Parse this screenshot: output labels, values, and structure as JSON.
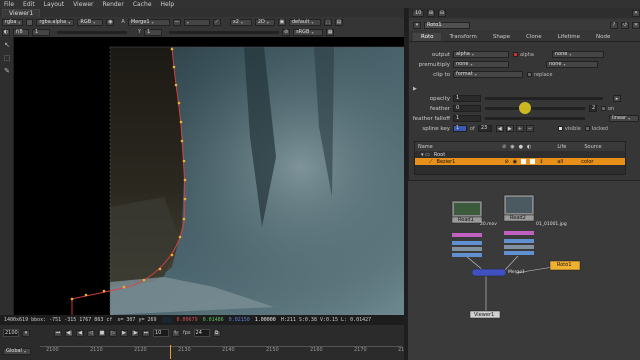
{
  "menu": [
    "File",
    "Edit",
    "Layout",
    "Viewer",
    "Render",
    "Cache",
    "Help"
  ],
  "viewer": {
    "tab": "Viewer1",
    "toolbar1": {
      "channels": "rgba",
      "layer": "rgba.alpha",
      "colorspace": "RGB",
      "input_a": "A",
      "merge": "Merge1",
      "zoom": "x2",
      "mode": "2D",
      "lut": "default"
    },
    "toolbar2": {
      "fstop": "f/8",
      "frame_val": "1",
      "y_label": "Y",
      "y_val": "1",
      "colorspace": "sRGB"
    },
    "status": {
      "info": "1400x619 bbox: -751 -315 1767 863 cf",
      "coords": "x= 307 y= 269",
      "r": "0.00679",
      "g": "0.01486",
      "b": "0.02150",
      "a": "1.00000",
      "hsvl": "H:211 S:0.38 V:0.15 L: 0.01427"
    }
  },
  "timeline": {
    "current_frame": "2100",
    "ticks": [
      "2100",
      "2110",
      "2120",
      "2130",
      "2140",
      "2150",
      "2160",
      "2170",
      "2180"
    ],
    "fps_label": "fps",
    "fps": "24",
    "step": "10",
    "range_mode": "Global"
  },
  "properties": {
    "top_count": "10",
    "node_name": "Roto1",
    "tabs": [
      "Roto",
      "Transform",
      "Shape",
      "Clone",
      "Lifetime",
      "Node"
    ],
    "output": {
      "label": "output",
      "value": "alpha",
      "check_label": "alpha",
      "extra": "none"
    },
    "premultiply": {
      "label": "premultiply",
      "value": "none",
      "extra": "none"
    },
    "clip_to": {
      "label": "clip to",
      "value": "format",
      "check_label": "replace"
    },
    "opacity": {
      "label": "opacity",
      "value": "1"
    },
    "feather": {
      "label": "feather",
      "value": "0",
      "on_label": "on",
      "num": "2"
    },
    "feather_falloff": {
      "label": "feather falloff",
      "value": "1",
      "curve": "linear"
    },
    "spline_key": {
      "label": "spline key",
      "value": "1",
      "of": "of",
      "total": "23",
      "visible": "visible",
      "locked": "locked"
    },
    "layers": {
      "headers": [
        "Name",
        "Life",
        "Source"
      ],
      "rows": [
        {
          "name": "Root",
          "life": "",
          "source": ""
        },
        {
          "name": "Bezier1",
          "life": "all",
          "source": "color"
        }
      ]
    }
  },
  "nodegraph": {
    "read1": "Read1",
    "read2": "Read2",
    "read1_file": "20.mov",
    "read2_file": "01_01001.jpg",
    "roto": "Roto1",
    "viewer": "Viewer1",
    "merge_label": "Merge1"
  },
  "colors": {
    "accent": "#e8901a",
    "roto_node": "#f0b030",
    "read_node": "#8a8a8a",
    "spline": "#e04040"
  }
}
